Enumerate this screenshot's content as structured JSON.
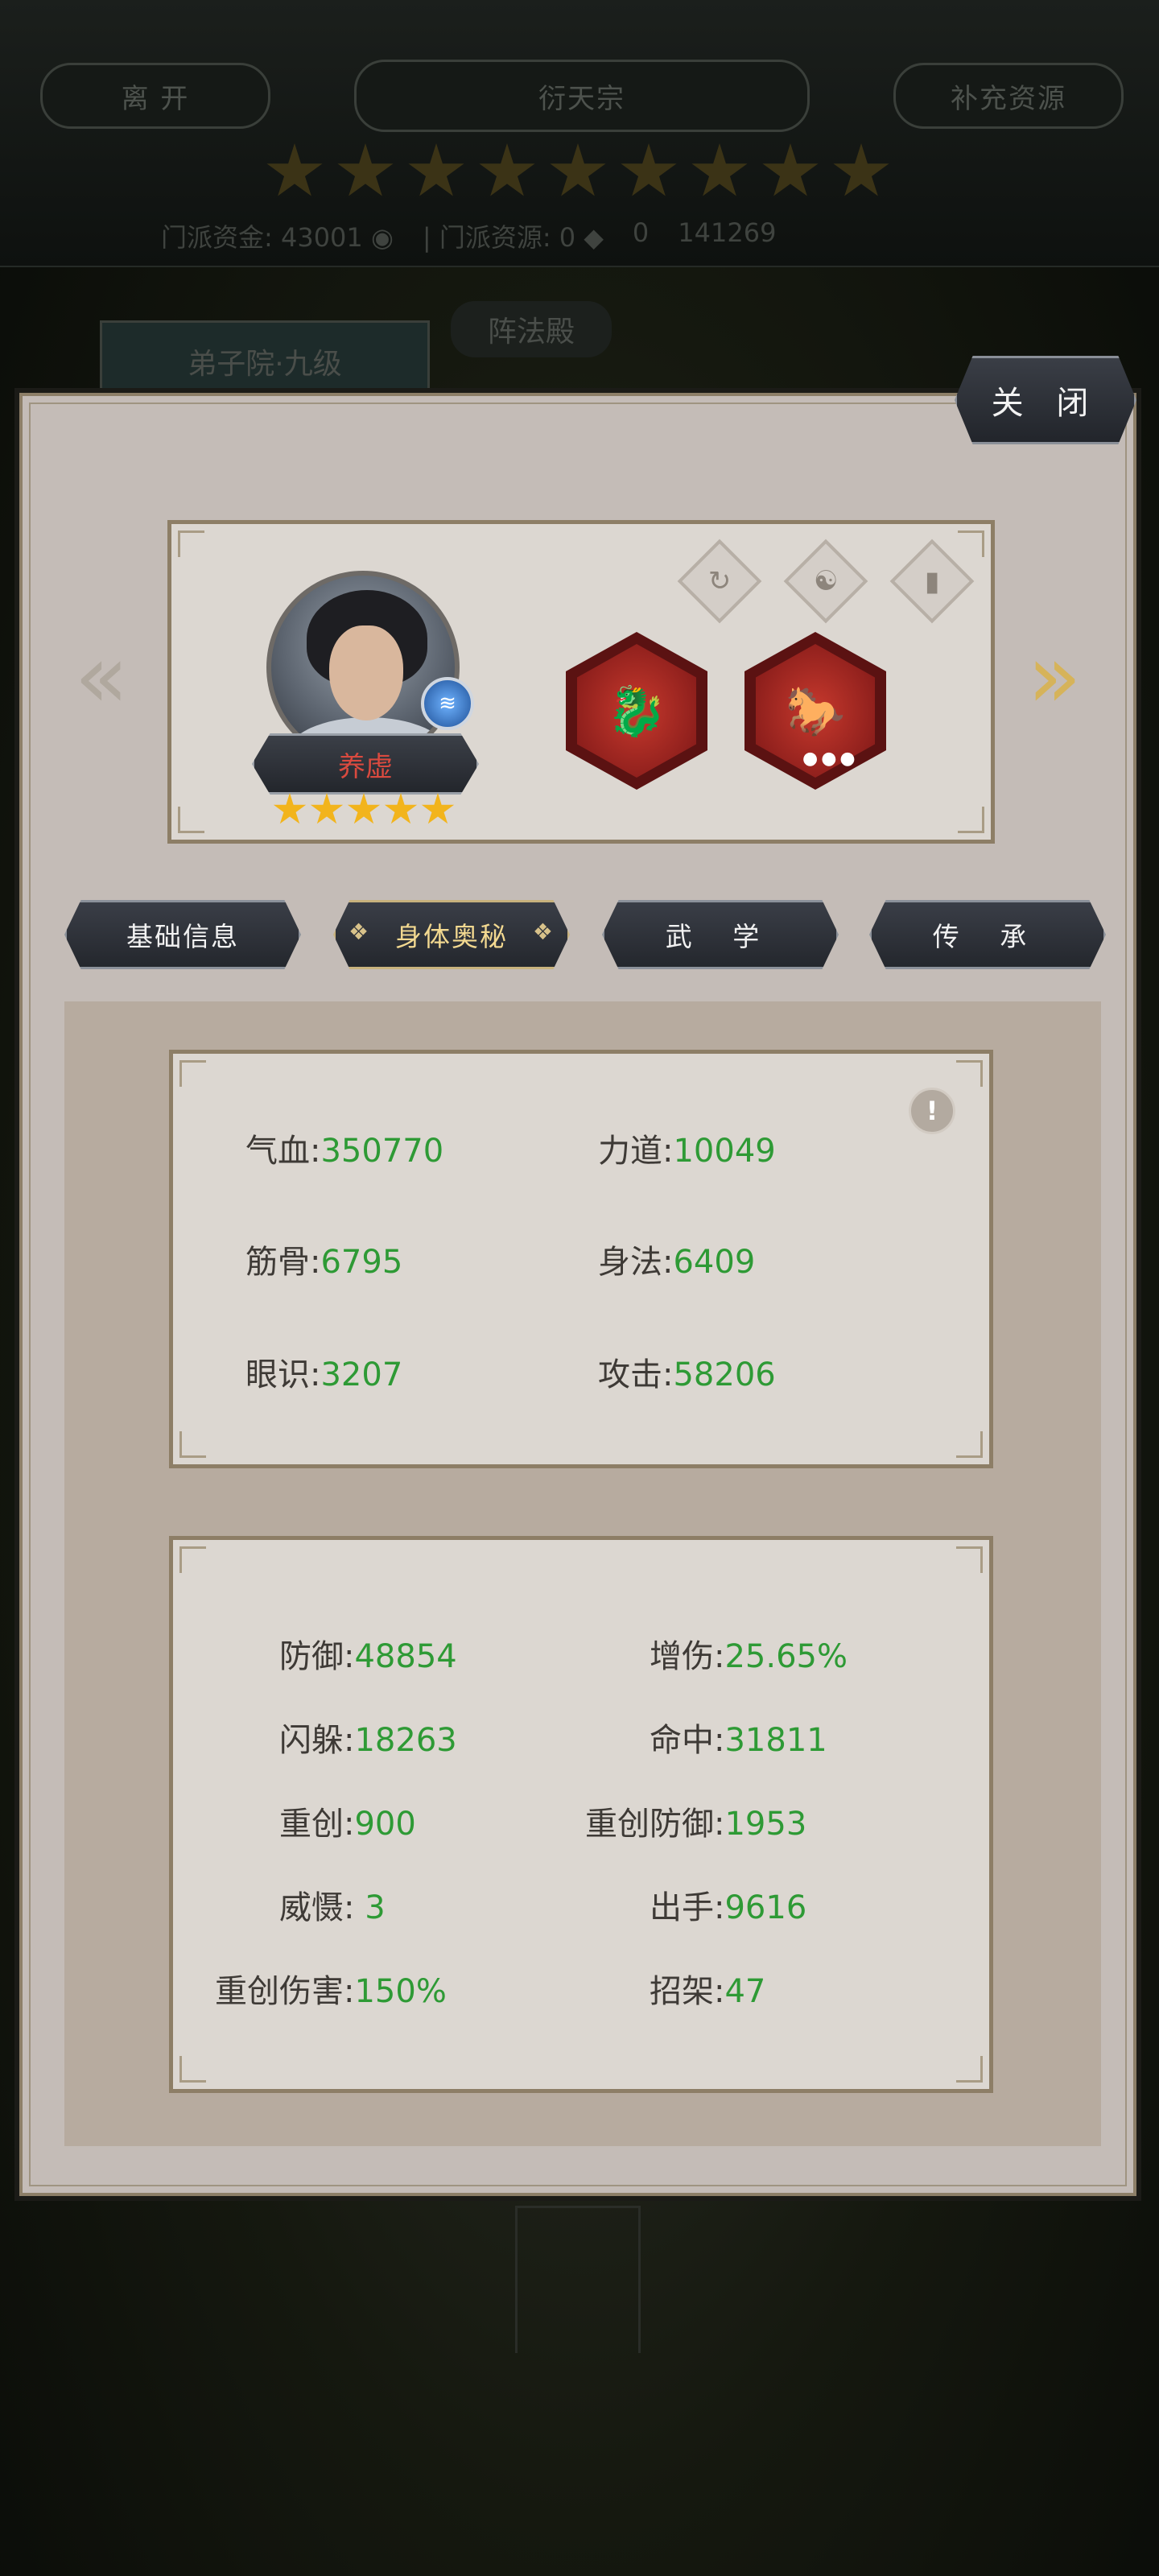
{
  "background": {
    "leave_label": "离 开",
    "sect_name": "衍天宗",
    "supply_label": "补充资源",
    "sect_funds_label": "门派资金:",
    "sect_funds_value": "43001",
    "sect_resource_label": "门派资源:",
    "sect_resource_value": "0",
    "resource_3": "0",
    "resource_4": "141269",
    "disciple_tab": "弟子院·九级",
    "formation_tab": "阵法殿"
  },
  "close_label": "关 闭",
  "hero": {
    "name": "养虚",
    "stars": 5
  },
  "tabs": [
    {
      "label": "基础信息"
    },
    {
      "label": "身体奥秘"
    },
    {
      "label": "武 学"
    },
    {
      "label": "传 承"
    }
  ],
  "base_stats": {
    "hp_label": "气血:",
    "hp": "350770",
    "str_label": "力道:",
    "str": "10049",
    "bone_label": "筋骨:",
    "bone": "6795",
    "agi_label": "身法:",
    "agi": "6409",
    "insight_label": "眼识:",
    "insight": "3207",
    "atk_label": "攻击:",
    "atk": "58206"
  },
  "combat_stats": {
    "def_label": "防御:",
    "def": "48854",
    "dmg_up_label": "增伤:",
    "dmg_up": "25.65%",
    "dodge_label": "闪躲:",
    "dodge": "18263",
    "hit_label": "命中:",
    "hit": "31811",
    "crit_label": "重创:",
    "crit": "900",
    "crit_def_label": "重创防御:",
    "crit_def": "1953",
    "awe_label": "威慑:",
    "awe": " 3",
    "speed_label": "出手:",
    "speed": "9616",
    "crit_dmg_label": "重创伤害:",
    "crit_dmg": "150%",
    "parry_label": "招架:",
    "parry": "47"
  },
  "colors": {
    "value_green": "#2e9a35",
    "name_red": "#d94a3f",
    "star_gold": "#f2b41c",
    "panel": "#c4bcb7"
  }
}
